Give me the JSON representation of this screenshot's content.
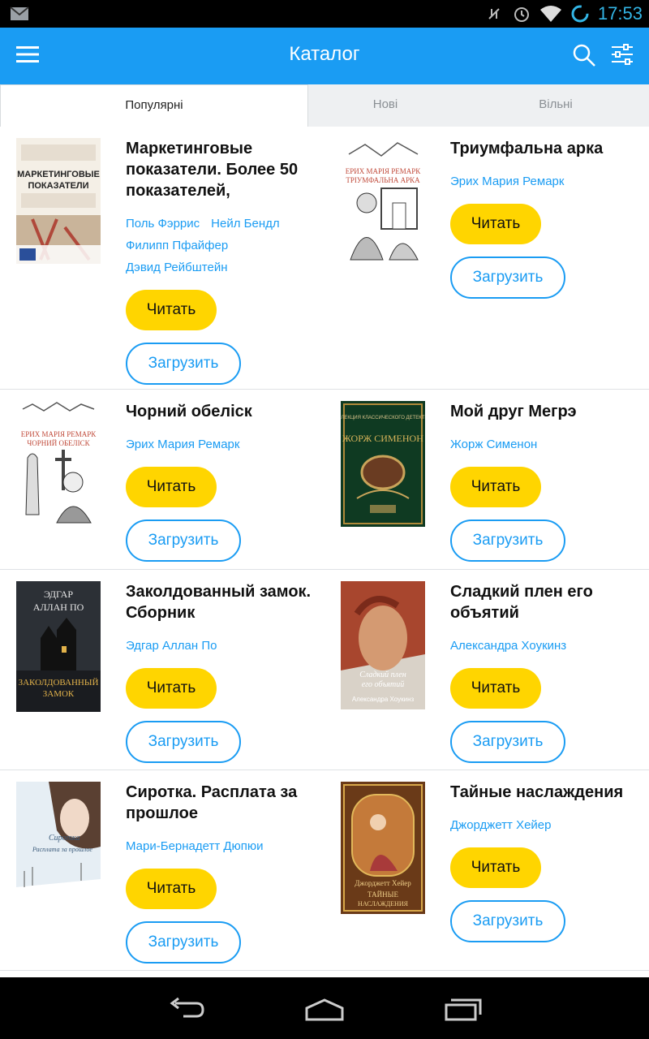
{
  "status": {
    "time": "17:53"
  },
  "app_bar": {
    "title": "Каталог"
  },
  "tabs": [
    {
      "label": "Популярні"
    },
    {
      "label": "Нові"
    },
    {
      "label": "Вільні"
    }
  ],
  "buttons": {
    "read": "Читать",
    "download": "Загрузить"
  },
  "books": [
    {
      "title": "Маркетинговые показатели. Более 50 показателей,",
      "authors": [
        "Поль Фэррис",
        "Нейл Бендл",
        "Филипп Пфайфер",
        "Дэвид Рейбштейн"
      ],
      "cover_text": "МАРКЕТИНГОВЫЕ ПОКАЗАТЕЛИ"
    },
    {
      "title": "Триумфальна арка",
      "authors": [
        "Эрих Мария Ремарк"
      ],
      "cover_text": "ЕРИХ МАРІЯ РЕМАРК ТРІУМФАЛЬНА АРКА"
    },
    {
      "title": "Чорний обеліск",
      "authors": [
        "Эрих Мария Ремарк"
      ],
      "cover_text": "ЕРИХ МАРІЯ РЕМАРК ЧОРНИЙ ОБЕЛІСК"
    },
    {
      "title": "Мой друг Мегрэ",
      "authors": [
        "Жорж Сименон"
      ],
      "cover_text": "ЖОРЖ СИМЕНОН"
    },
    {
      "title": "Заколдованный замок. Сборник",
      "authors": [
        "Эдгар Аллан По"
      ],
      "cover_text": "ЭДГАР АЛЛАН ПО"
    },
    {
      "title": "Сладкий плен его объятий",
      "authors": [
        "Александра Хоукинз"
      ],
      "cover_text": "Сладкий плен его объятий"
    },
    {
      "title": "Сиротка. Расплата за прошлое",
      "authors": [
        "Мари-Бернадетт Дюпюи"
      ],
      "cover_text": "Сиротка"
    },
    {
      "title": "Тайные наслаждения",
      "authors": [
        "Джорджетт Хейер"
      ],
      "cover_text": "ТАЙНЫЕ НАСЛАЖДЕНИЯ"
    }
  ],
  "colors": {
    "accent": "#1a9cf3",
    "read_button": "#ffd500",
    "status_bar": "#000000"
  }
}
